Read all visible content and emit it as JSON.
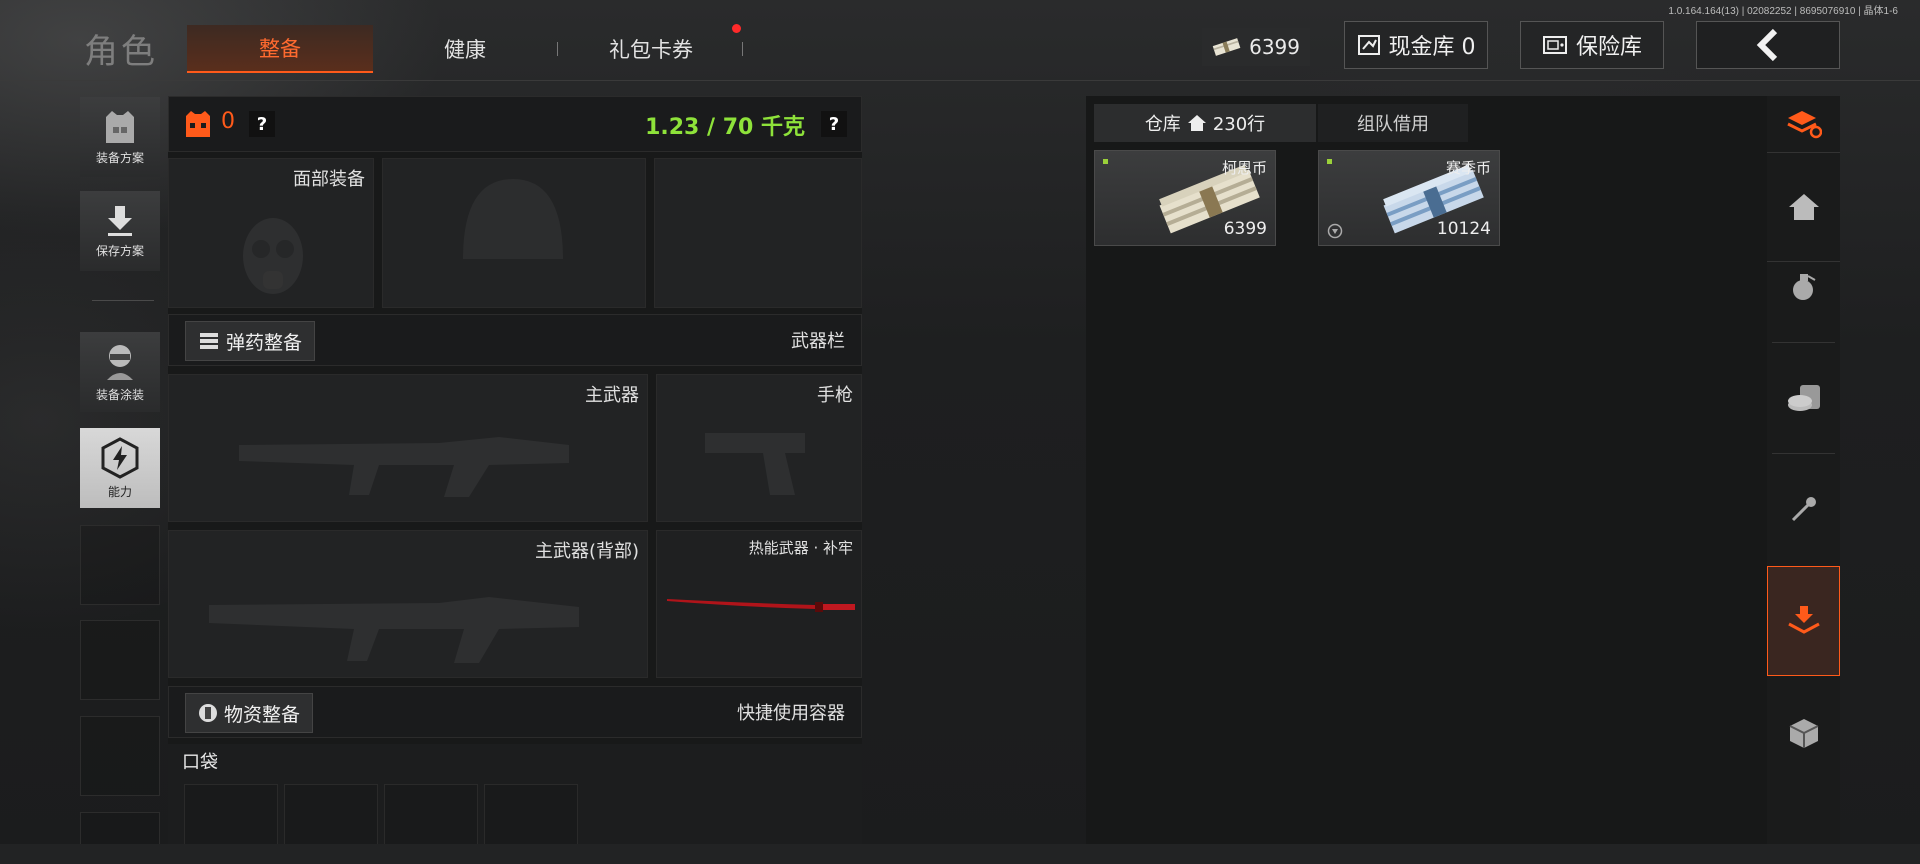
{
  "version": "1.0.164.164(13) | 02082252 | 8695076910 | 晶体1-6",
  "title": "角色",
  "tabs": [
    {
      "label": "整备"
    },
    {
      "label": "健康"
    },
    {
      "label": "礼包卡券"
    }
  ],
  "header": {
    "currency_value": "6399",
    "cash_label": "现金库 0",
    "safe_label": "保险库"
  },
  "left_menu": [
    {
      "label": "装备方案"
    },
    {
      "label": "保存方案"
    },
    {
      "label": "装备涂装"
    },
    {
      "label": "能力"
    }
  ],
  "status": {
    "armor_count": "0",
    "weight": "1.23 / 70 千克"
  },
  "slots": {
    "face": "面部装备",
    "primary": "主武器",
    "pistol": "手枪",
    "primary_back": "主武器(背部)",
    "thermal": "热能武器 · 补牢",
    "pocket": "口袋"
  },
  "sections": {
    "ammo_btn": "弹药整备",
    "weapon_bar": "武器栏",
    "supply_btn": "物资整备",
    "quick_container": "快捷使用容器"
  },
  "warehouse": {
    "tab_label": "仓库",
    "rows": "230行",
    "team_label": "组队借用",
    "items": [
      {
        "name": "柯恩币",
        "count": "6399"
      },
      {
        "name": "赛季币",
        "count": "10124"
      }
    ]
  },
  "colors": {
    "accent": "#ff5a1a",
    "weight_green": "#8ee23a"
  }
}
